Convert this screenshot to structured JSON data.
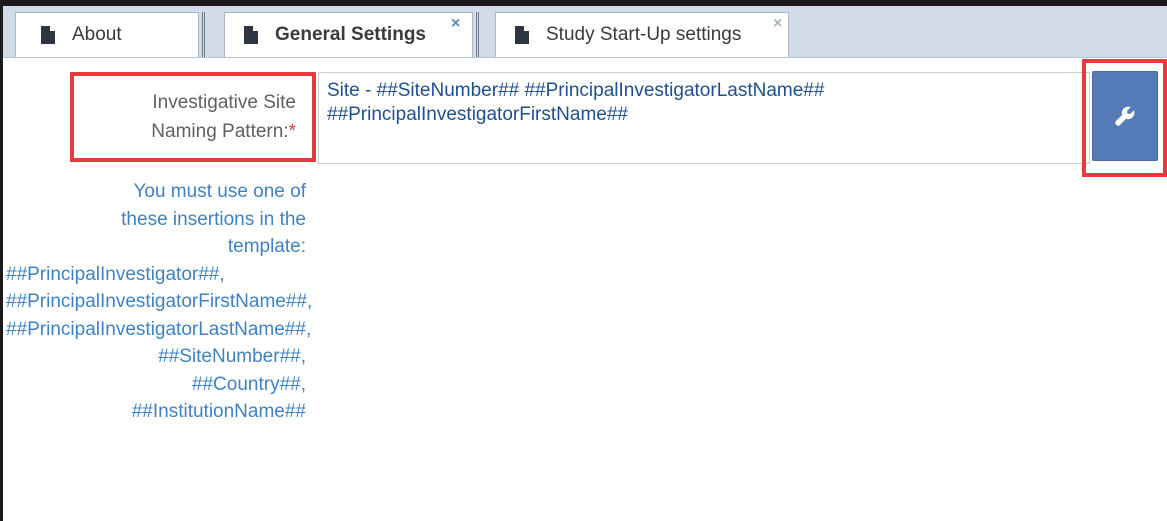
{
  "tabs": [
    {
      "label": "About",
      "closable": false,
      "active": false
    },
    {
      "label": "General Settings",
      "closable": true,
      "active": true
    },
    {
      "label": "Study Start-Up settings",
      "closable": true,
      "active": false
    }
  ],
  "close_glyph": "×",
  "field": {
    "label_line1": "Investigative Site",
    "label_line2": "Naming Pattern:",
    "required_marker": "*",
    "value": "Site - ##SiteNumber## ##PrincipalInvestigatorLastName##\n##PrincipalInvestigatorFirstName##",
    "action_icon": "wrench-icon"
  },
  "help": {
    "lines": [
      "You must use one of",
      "these insertions in the",
      "template:",
      "##PrincipalInvestigator##,",
      "##PrincipalInvestigatorFirstName##,",
      "##PrincipalInvestigatorLastName##,",
      "##SiteNumber##,",
      "##Country##,",
      "##InstitutionName##"
    ]
  },
  "colors": {
    "highlight": "#e43b3f",
    "help_text": "#3f82c4",
    "field_text": "#1f4f8f",
    "button_bg": "#547ab7",
    "tabbar_bg": "#d2dbe8"
  }
}
